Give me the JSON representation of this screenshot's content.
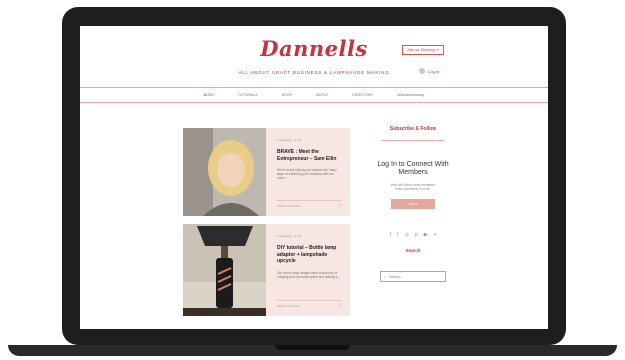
{
  "site": {
    "logo": "Dannells",
    "tagline": "ALL ABOUT CRAFT BUSINESS & LAMPSHADE MAKING",
    "join_label": "Join our Directory ➜",
    "login_label": "Log In"
  },
  "nav": {
    "items": [
      {
        "label": "BLOG"
      },
      {
        "label": "TUTORIALS"
      },
      {
        "label": "SHOP"
      },
      {
        "label": "ABOUT"
      },
      {
        "label": "DIRECTORY"
      },
      {
        "label": "#thedannellsway"
      }
    ]
  },
  "posts": [
    {
      "meta": "3 days ago · 3 min",
      "title": "BRAVE : Meet the Entrepreneur – Sam Ellin",
      "excerpt": "We've loved helping you explore the many ways of exploring your business with our more...",
      "comments": "Write a comment"
    },
    {
      "meta": "3 days ago · 3 min",
      "title": "DIY tutorial – Bottle lamp adaptor + lampshade upcycle",
      "excerpt": "Our lovely lamp design came a new one of bringing your favourite spirits and making a...",
      "comments": "Write a comment"
    }
  ],
  "sidebar": {
    "subscribe_heading": "Subscribe & Follow",
    "login_title": "Log In to Connect With Members",
    "login_text": "View and follow other members, leave comments & more.",
    "login_button": "Log In",
    "social_icons": [
      "facebook-icon",
      "twitter-icon",
      "instagram-icon",
      "pinterest-icon",
      "youtube-icon",
      "vimeo-icon"
    ],
    "search_heading": "Search",
    "search_placeholder": "Search..."
  },
  "colors": {
    "brand": "#c8313e",
    "post_bg": "#f8e6e2",
    "button": "#e6a69a",
    "laptop": "#1e1e1e"
  }
}
